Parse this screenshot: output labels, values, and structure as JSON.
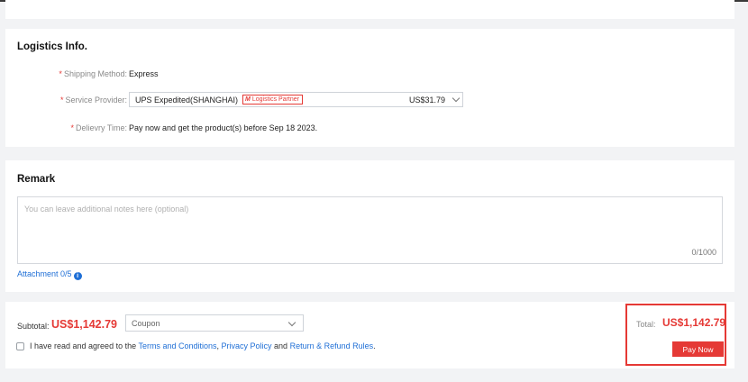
{
  "logistics": {
    "title": "Logistics Info.",
    "required_mark": "*",
    "shipping_method_label": "Shipping Method:",
    "shipping_method_value": "Express",
    "service_provider_label": "Service Provider:",
    "service_provider_value": "UPS Expedited(SHANGHAI)",
    "partner_badge_logo": "M",
    "partner_badge_text": "Logistics Partner",
    "service_provider_price": "US$31.79",
    "delivery_time_label": "Delievry Time:",
    "delivery_time_value": "Pay now and get the product(s) before Sep 18 2023."
  },
  "remark": {
    "title": "Remark",
    "placeholder": "You can leave additional notes here (optional)",
    "char_count": "0/1000",
    "attachment_label": "Attachment 0/5",
    "info_icon_glyph": "i"
  },
  "checkout": {
    "subtotal_label": "Subtotal:",
    "subtotal_value": "US$1,142.79",
    "coupon_placeholder": "Coupon",
    "agree_prefix": "I have read and agreed to the",
    "terms_link": "Terms and Conditions",
    "comma": ",",
    "privacy_link": "Privacy Policy",
    "and_text": "and",
    "refund_link": "Return & Refund Rules",
    "period": ".",
    "total_label": "Total:",
    "total_value": "US$1,142.79",
    "pay_button": "Pay Now"
  },
  "colors": {
    "accent_red": "#e53935",
    "link_blue": "#1f6fd6",
    "background": "#f2f3f5"
  },
  "icons": [
    "chevron-down-icon",
    "info-icon",
    "checkbox-icon",
    "logistics-partner-logo"
  ]
}
